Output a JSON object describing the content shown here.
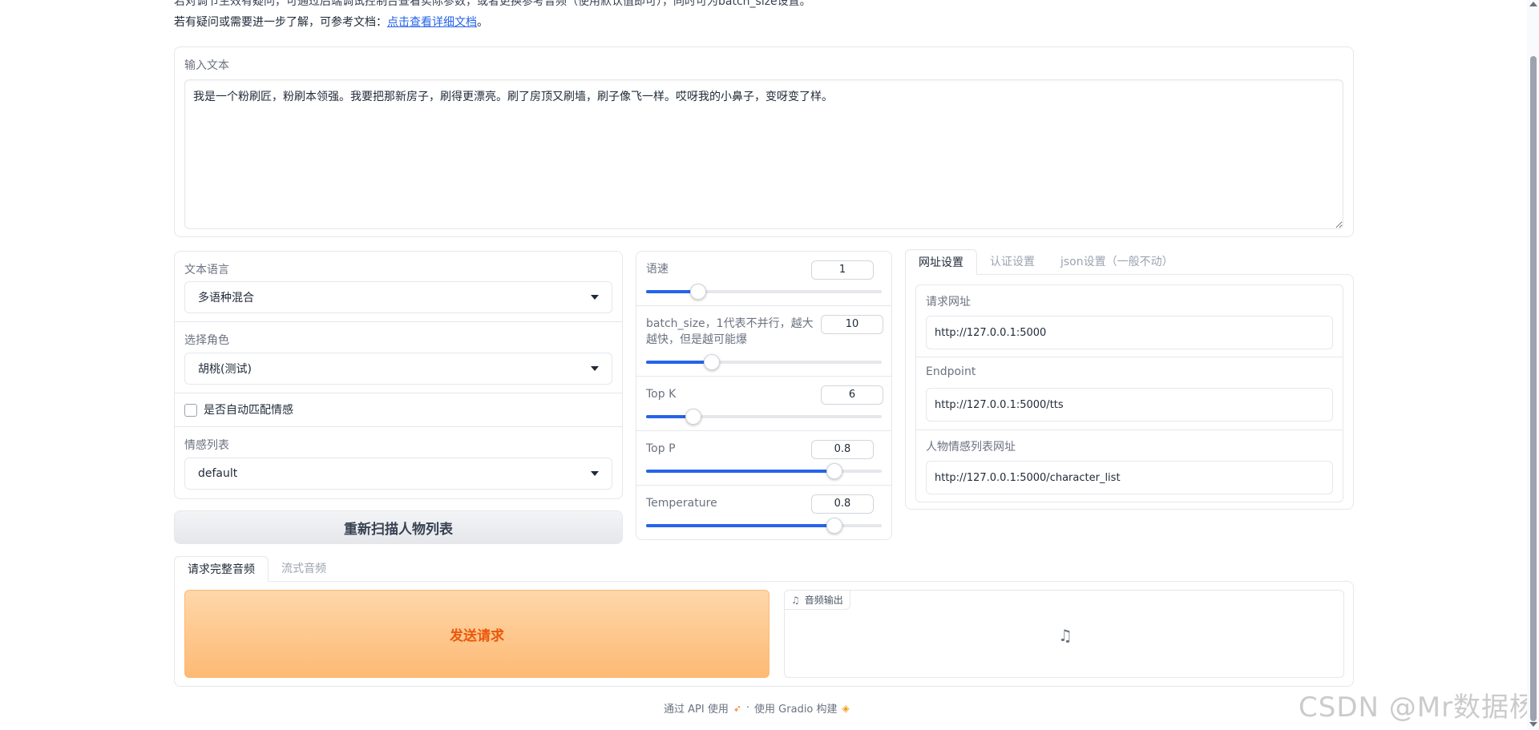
{
  "intro": {
    "line1": "若对调节生效有疑问，可通过后端调试控制台查看实际参数，或者更换参考音频（使用默认值即可），同时可为batch_size设置。",
    "line2_prefix": "若有疑问或需要进一步了解，可参考文档：",
    "line2_link": "点击查看详细文档",
    "line2_suffix": "。"
  },
  "input_text": {
    "label": "输入文本",
    "value": "我是一个粉刷匠，粉刷本领强。我要把那新房子，刷得更漂亮。刷了房顶又刷墙，刷子像飞一样。哎呀我的小鼻子，变呀变了样。"
  },
  "left": {
    "text_language": {
      "label": "文本语言",
      "value": "多语种混合"
    },
    "character": {
      "label": "选择角色",
      "value": "胡桃(测试)"
    },
    "auto_emotion": {
      "label": "是否自动匹配情感",
      "checked": false
    },
    "emotion_list": {
      "label": "情感列表",
      "value": "default"
    },
    "rescan_button": "重新扫描人物列表"
  },
  "sliders": [
    {
      "label": "语速",
      "value": "1",
      "fraction": 0.22
    },
    {
      "label": "batch_size，1代表不并行，越大越快，但是越可能爆",
      "value": "10",
      "fraction": 0.28
    },
    {
      "label": "Top K",
      "value": "6",
      "fraction": 0.2
    },
    {
      "label": "Top P",
      "value": "0.8",
      "fraction": 0.8
    },
    {
      "label": "Temperature",
      "value": "0.8",
      "fraction": 0.8
    }
  ],
  "settings_tabs": [
    "网址设置",
    "认证设置",
    "json设置（一般不动）"
  ],
  "url_settings": {
    "request_url": {
      "label": "请求网址",
      "value": "http://127.0.0.1:5000"
    },
    "endpoint": {
      "label": "Endpoint",
      "value": "http://127.0.0.1:5000/tts"
    },
    "character_list_url": {
      "label": "人物情感列表网址",
      "value": "http://127.0.0.1:5000/character_list"
    }
  },
  "bottom_tabs": [
    "请求完整音频",
    "流式音频"
  ],
  "send_button": "发送请求",
  "audio_output_label": "音频输出",
  "footer": {
    "api": "通过 API 使用",
    "sep": "·",
    "gradio": "使用 Gradio 构建"
  },
  "watermark": "CSDN @Mr数据杨",
  "colors": {
    "accent": "#2563eb",
    "send_text": "#ea580c",
    "send_bg": "#fdba74"
  }
}
